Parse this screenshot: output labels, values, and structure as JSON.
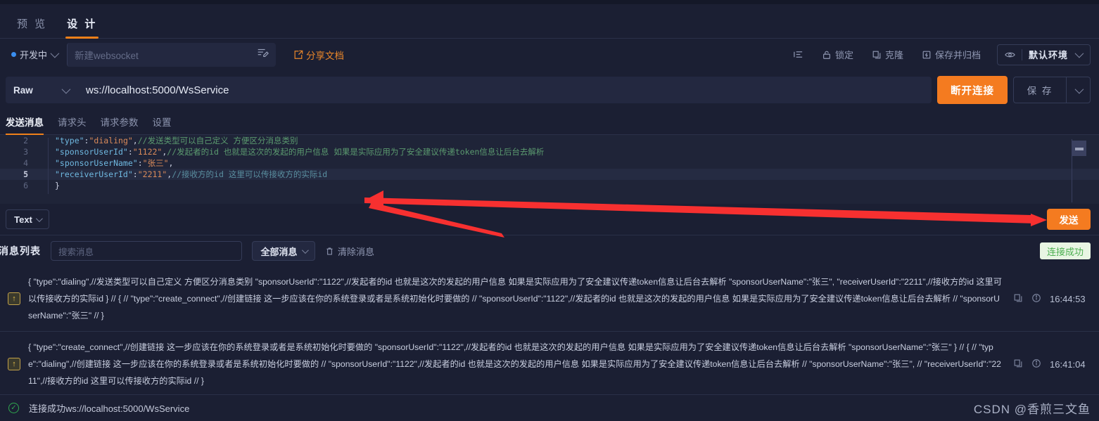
{
  "tabs": [
    {
      "label": "预 览",
      "active": false
    },
    {
      "label": "设 计",
      "active": true
    }
  ],
  "name_row": {
    "status_label": "开发中",
    "name_placeholder": "新建websocket",
    "share_label": "分享文档",
    "tools": [
      {
        "label": "",
        "icon": "list-icon"
      },
      {
        "label": "锁定",
        "icon": "lock-icon"
      },
      {
        "label": "克隆",
        "icon": "copy-icon"
      },
      {
        "label": "保存并归档",
        "icon": "archive-icon"
      }
    ],
    "env_icon": "eye-icon",
    "env_name": "默认环境"
  },
  "url_row": {
    "method": "Raw",
    "url": "ws://localhost:5000/WsService",
    "primary_button": "断开连接",
    "save_button": "保 存"
  },
  "sub_tabs": [
    {
      "label": "发送消息",
      "active": true
    },
    {
      "label": "请求头",
      "active": false
    },
    {
      "label": "请求参数",
      "active": false
    },
    {
      "label": "设置",
      "active": false
    }
  ],
  "editor": {
    "lines": [
      {
        "num": "2",
        "current": false,
        "tokens": [
          {
            "t": "\"type\"",
            "c": "k-key"
          },
          {
            "t": ":",
            "c": "k-pun"
          },
          {
            "t": "\"dialing\"",
            "c": "k-str"
          },
          {
            "t": ",",
            "c": "k-pun"
          },
          {
            "t": "//发送类型可以自己定义    方便区分消息类别",
            "c": "k-com"
          }
        ]
      },
      {
        "num": "3",
        "current": false,
        "tokens": [
          {
            "t": "\"sponsorUserId\"",
            "c": "k-key"
          },
          {
            "t": ":",
            "c": "k-pun"
          },
          {
            "t": "\"1122\"",
            "c": "k-str"
          },
          {
            "t": ",",
            "c": "k-pun"
          },
          {
            "t": "//发起者的id   也就是这次的发起的用户信息    如果是实际应用为了安全建议传递token信息让后台去解析",
            "c": "k-com"
          }
        ]
      },
      {
        "num": "4",
        "current": false,
        "tokens": [
          {
            "t": "\"sponsorUserName\"",
            "c": "k-key"
          },
          {
            "t": ":",
            "c": "k-pun"
          },
          {
            "t": "\"张三\"",
            "c": "k-str"
          },
          {
            "t": ",",
            "c": "k-pun"
          }
        ]
      },
      {
        "num": "5",
        "current": true,
        "tokens": [
          {
            "t": "\"receiverUserId\"",
            "c": "k-key"
          },
          {
            "t": ":",
            "c": "k-pun"
          },
          {
            "t": "\"2211\"",
            "c": "k-str"
          },
          {
            "t": ",",
            "c": "k-pun"
          },
          {
            "t": "//接收方的id   这里可以传接收方的实际id",
            "c": "k-cm2"
          }
        ]
      },
      {
        "num": "6",
        "current": false,
        "tokens": [
          {
            "t": "}",
            "c": "k-pun"
          }
        ]
      }
    ]
  },
  "send_row": {
    "format": "Text",
    "send_button": "发送"
  },
  "msg_list": {
    "title": "消息列表",
    "search_placeholder": "搜索消息",
    "filter": "全部消息",
    "clear_label": "清除消息",
    "status_badge": "连接成功",
    "messages": [
      {
        "direction": "up",
        "text": "{ \"type\":\"dialing\",//发送类型可以自己定义 方便区分消息类别 \"sponsorUserId\":\"1122\",//发起者的id 也就是这次的发起的用户信息 如果是实际应用为了安全建议传递token信息让后台去解析 \"sponsorUserName\":\"张三\", \"receiverUserId\":\"2211\",//接收方的id 这里可以传接收方的实际id } // { // \"type\":\"create_connect\",//创建链接 这一步应该在你的系统登录或者是系统初始化时要做的 // \"sponsorUserId\":\"1122\",//发起者的id 也就是这次的发起的用户信息 如果是实际应用为了安全建议传递token信息让后台去解析 // \"sponsorUserName\":\"张三\" // }",
        "time": "16:44:53"
      },
      {
        "direction": "up",
        "text": "{ \"type\":\"create_connect\",//创建链接 这一步应该在你的系统登录或者是系统初始化时要做的 \"sponsorUserId\":\"1122\",//发起者的id 也就是这次的发起的用户信息 如果是实际应用为了安全建议传递token信息让后台去解析 \"sponsorUserName\":\"张三\" } // { // \"type\":\"dialing\",//创建链接 这一步应该在你的系统登录或者是系统初始化时要做的 // \"sponsorUserId\":\"1122\",//发起者的id 也就是这次的发起的用户信息 如果是实际应用为了安全建议传递token信息让后台去解析 // \"sponsorUserName\":\"张三\", // \"receiverUserId\":\"2211\",//接收方的id 这里可以传接收方的实际id // }",
        "time": "16:41:04"
      }
    ]
  },
  "bottom_bar": {
    "status_text": "连接成功ws://localhost:5000/WsService",
    "watermark": "CSDN @香煎三文鱼"
  },
  "colors": {
    "accent": "#f47b20",
    "bg": "#1b1f33",
    "editor_bg": "#1f2438",
    "success": "#4caf50",
    "annotation": "#f73030"
  }
}
